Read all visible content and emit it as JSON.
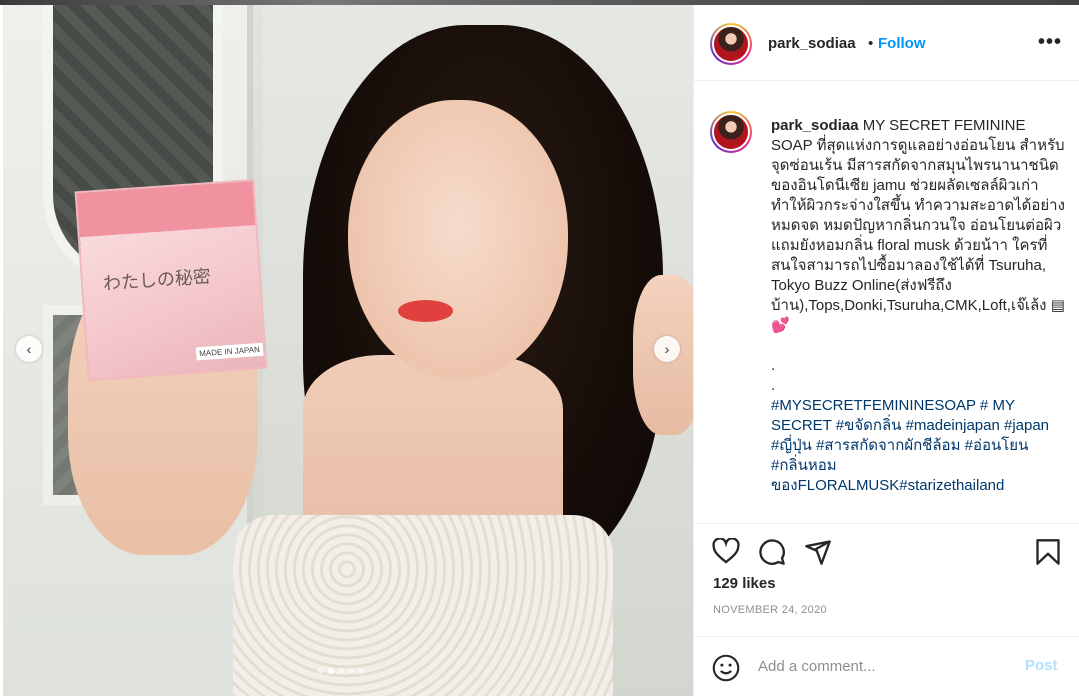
{
  "post": {
    "username": "park_sodiaa",
    "separator": "•",
    "follow_label": "Follow",
    "more_label": "•••",
    "image_box_text": "わたしの秘密",
    "image_box_made": "MADE IN JAPAN",
    "caption_username": "park_sodiaa",
    "caption_text": "MY SECRET FEMININE SOAP ที่สุดแห่งการดูแลอย่างอ่อนโยน สำหรับจุดซ่อนเร้น มีสารสกัดจากสมุนไพรนานาชนิดของอินโดนีเซีย jamu ช่วยผลัดเซลล์ผิวเก่า ทำให้ผิวกระจ่างใสขึ้น ทำความสะอาดได้อย่างหมดจด หมดปัญหากลิ่นกวนใจ อ่อนโยนต่อผิวแถมยังหอมกลิ่น floral musk ด้วยน้าา ใครที่สนใจสามารถไปซื้อมาลองใช้ได้ที่ Tsuruha, Tokyo Buzz Online(ส่งฟรีถึงบ้าน),Tops,Donki,Tsuruha,CMK,Loft,เจ๊เล้ง",
    "caption_emoji": "💕",
    "caption_dot1": ".",
    "caption_dot2": ".",
    "caption_tags_1": "#MYSECRETFEMININESOAP",
    "caption_tags_2": " # MY SECRET ",
    "caption_tags_3": "#ขจัดกลิ่น #madeinjapan #japan #ญี่ปุ่น #สารสกัดจากผักชีล้อม #อ่อนโยน #กลิ่นหอมของFLORALMUSK#starizethailand",
    "likes": "129 likes",
    "date": "NOVEMBER 24, 2020",
    "comment_placeholder": "Add a comment...",
    "post_label": "Post"
  },
  "carousel": {
    "total": 5,
    "active_index": 1
  },
  "colors": {
    "accent": "#0095f6",
    "post_disabled": "#b2dffc",
    "hashtag": "#00376b"
  }
}
